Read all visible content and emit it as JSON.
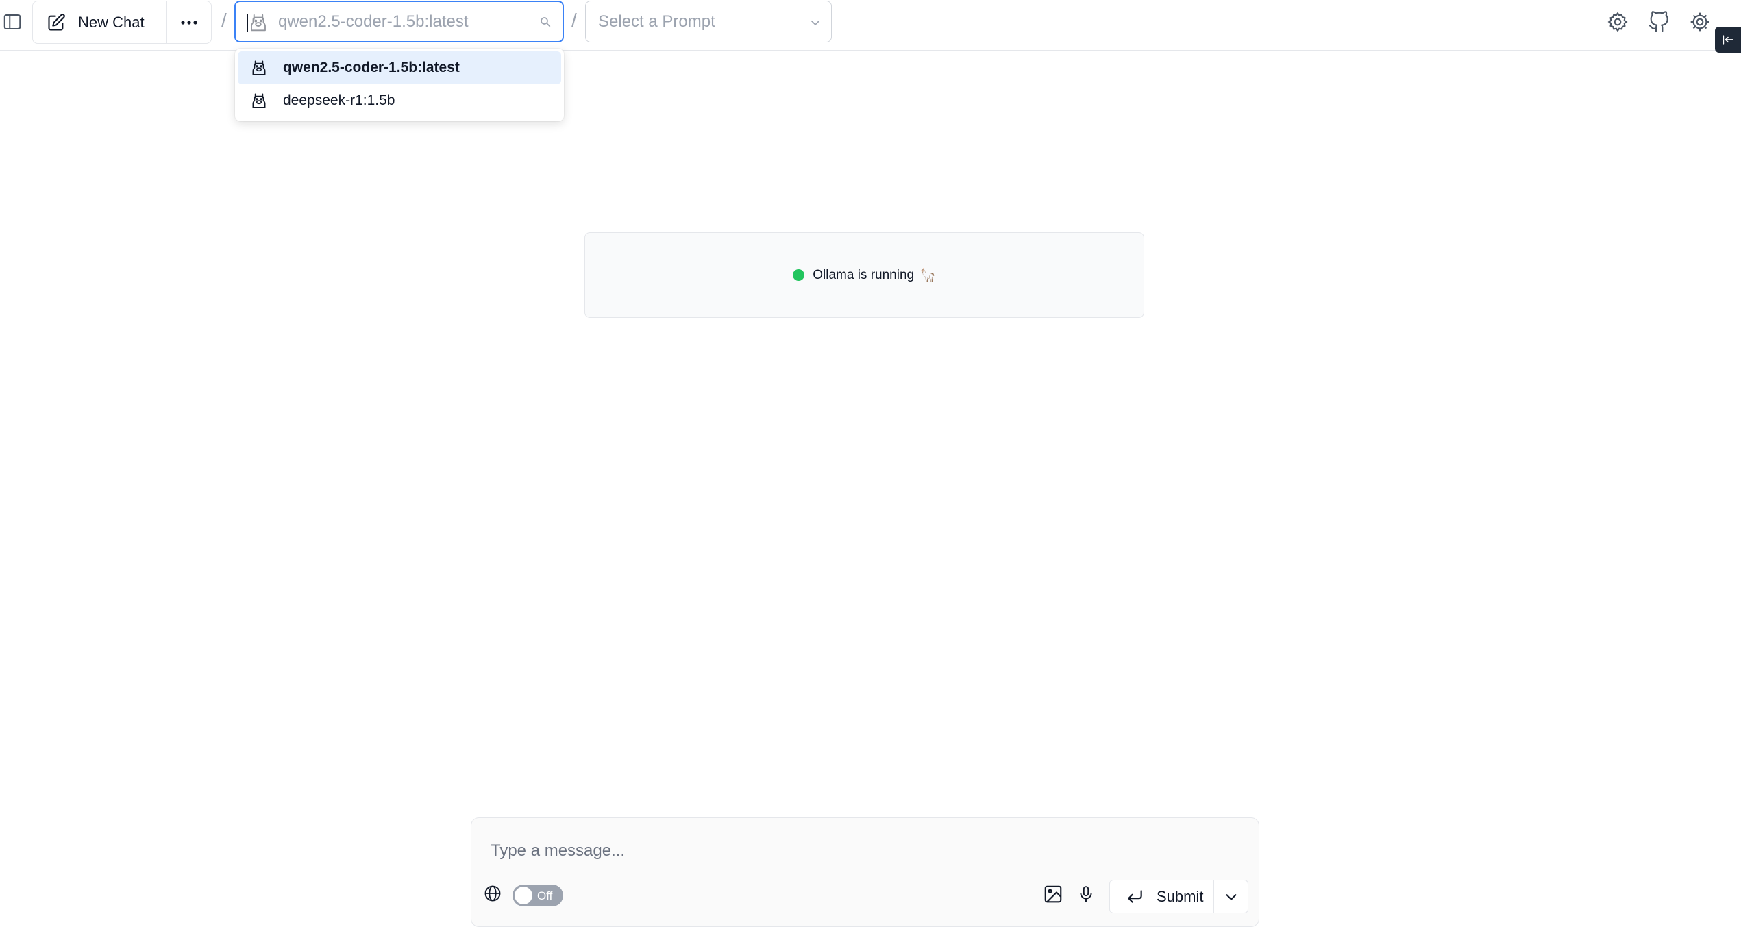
{
  "header": {
    "new_chat_label": "New Chat",
    "separator": "/",
    "model_search": {
      "value": "",
      "placeholder": "qwen2.5-coder-1.5b:latest"
    },
    "prompt_select": {
      "placeholder": "Select a Prompt"
    }
  },
  "model_dropdown": {
    "options": [
      {
        "label": "qwen2.5-coder-1.5b:latest",
        "selected": true
      },
      {
        "label": "deepseek-r1:1.5b",
        "selected": false
      }
    ]
  },
  "status": {
    "text": "Ollama is running",
    "emoji": "🦙",
    "color": "#22c55e"
  },
  "composer": {
    "placeholder": "Type a message...",
    "web_search_toggle": "Off",
    "submit_label": "Submit"
  },
  "icons": {
    "sidebar": "sidebar-icon",
    "new_chat": "pencil-square-icon",
    "more": "ellipsis-icon",
    "model": "llama-icon",
    "search": "search-icon",
    "chevron": "chevron-down-icon",
    "settings_left": "settings-icon",
    "github": "github-icon",
    "settings_right": "gear-icon",
    "collapse": "collapse-left-icon",
    "globe": "globe-icon",
    "image": "image-icon",
    "mic": "microphone-icon",
    "enter": "enter-icon"
  },
  "colors": {
    "accent": "#3b82f6",
    "selected_option_bg": "#e6f0fd",
    "toggle_off": "#9ca3af"
  }
}
